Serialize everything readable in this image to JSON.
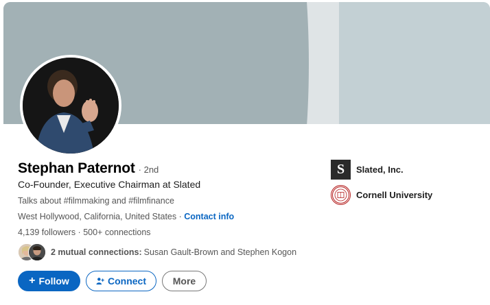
{
  "profile": {
    "name": "Stephan Paternot",
    "degree": "· 2nd",
    "headline": "Co-Founder, Executive Chairman at Slated",
    "talks_about": "Talks about #filmmaking and #filmfinance",
    "location": "West Hollywood, California, United States",
    "location_separator": " · ",
    "contact_info_label": "Contact info",
    "followers": "4,139 followers",
    "connections": "500+ connections",
    "stats_separator": " · ",
    "mutual_count": "2 mutual connections:",
    "mutual_names": "Susan Gault-Brown and Stephen Kogon"
  },
  "actions": {
    "follow_glyph": "+",
    "follow_label": "Follow",
    "connect_label": "Connect",
    "more_label": "More"
  },
  "orgs": [
    {
      "logo_letter": "S",
      "name": "Slated, Inc."
    },
    {
      "name": "Cornell University"
    }
  ],
  "colors": {
    "accent": "#0a66c2",
    "banner_dark": "#a2b1b5",
    "banner_light": "#c3d0d4"
  },
  "icons": {
    "connect": "add-person-icon"
  }
}
